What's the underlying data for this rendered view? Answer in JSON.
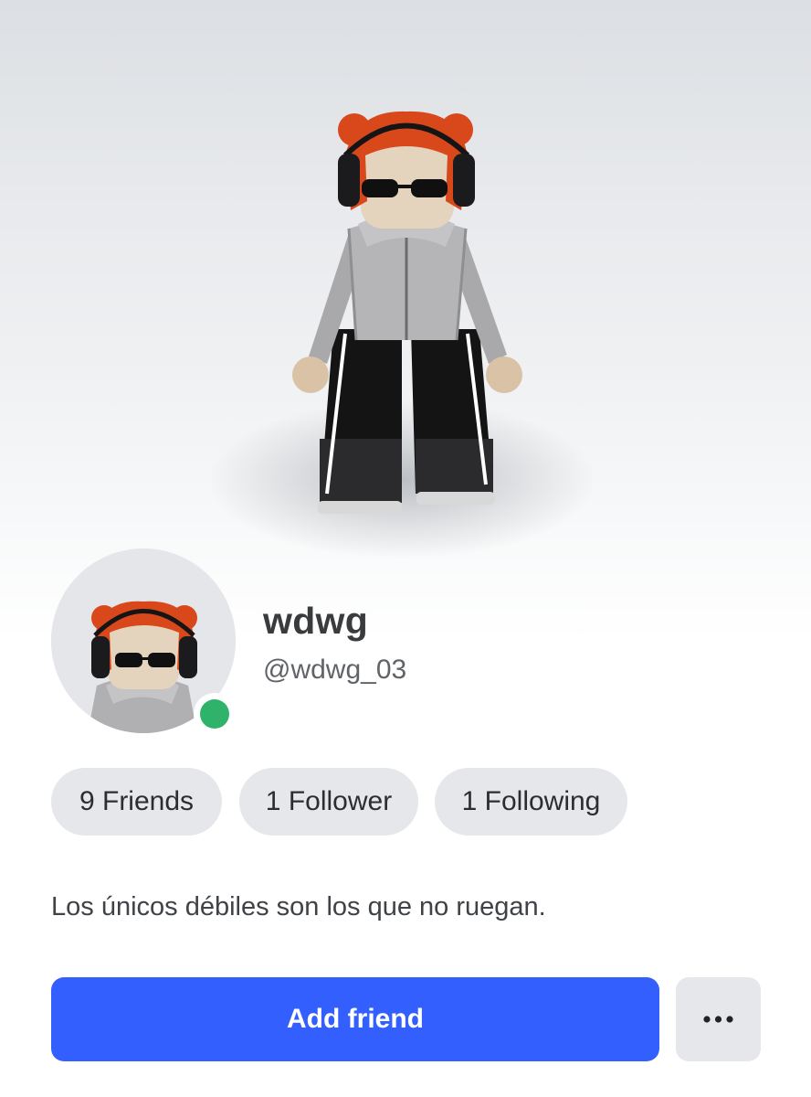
{
  "profile": {
    "display_name": "wdwg",
    "username": "@wdwg_03",
    "online_status_color": "#2fb36b",
    "bio": "Los únicos débiles son los que no ruegan."
  },
  "stats": {
    "friends": "9 Friends",
    "followers": "1 Follower",
    "following": "1 Following"
  },
  "actions": {
    "add_friend_label": "Add friend",
    "more_icon": "more-horizontal-icon",
    "accent_color": "#335fff"
  }
}
